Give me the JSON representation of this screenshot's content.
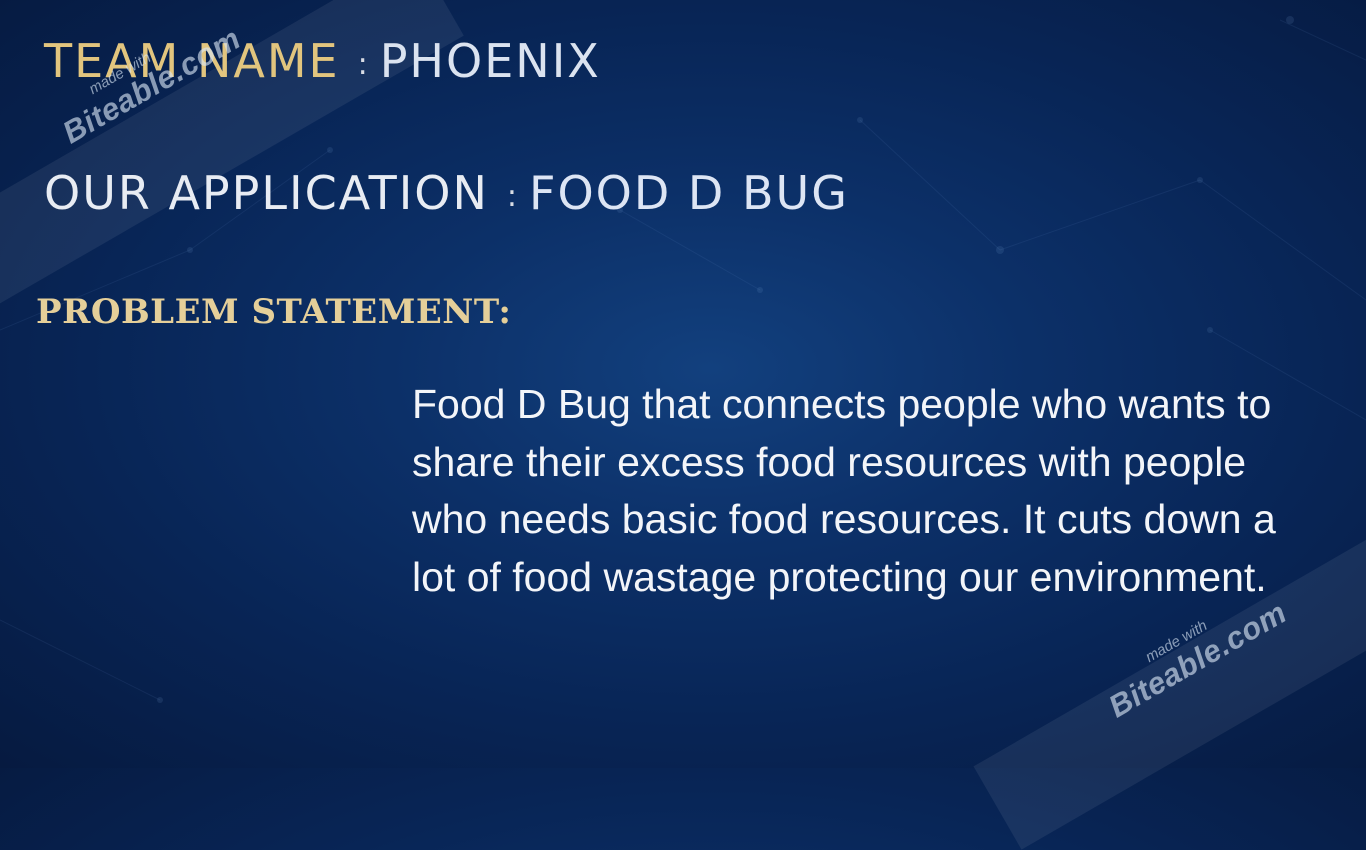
{
  "slide": {
    "team": {
      "label": "TEAM NAME",
      "separator": ":",
      "value": "PHOENIX"
    },
    "application": {
      "label": "OUR APPLICATION",
      "separator": ":",
      "value": "FOOD D BUG"
    },
    "problem_heading": "PROBLEM STATEMENT:",
    "problem_text": "Food D Bug that connects people who wants to share their excess food resources with people who needs basic food resources. It cuts down a lot of food wastage protecting our environment."
  },
  "watermark": {
    "made_with": "made with",
    "brand": "Biteable.com"
  },
  "colors": {
    "background": "#0a2b5e",
    "gold": "#e2c57e",
    "body_text": "#f3f5f9"
  }
}
